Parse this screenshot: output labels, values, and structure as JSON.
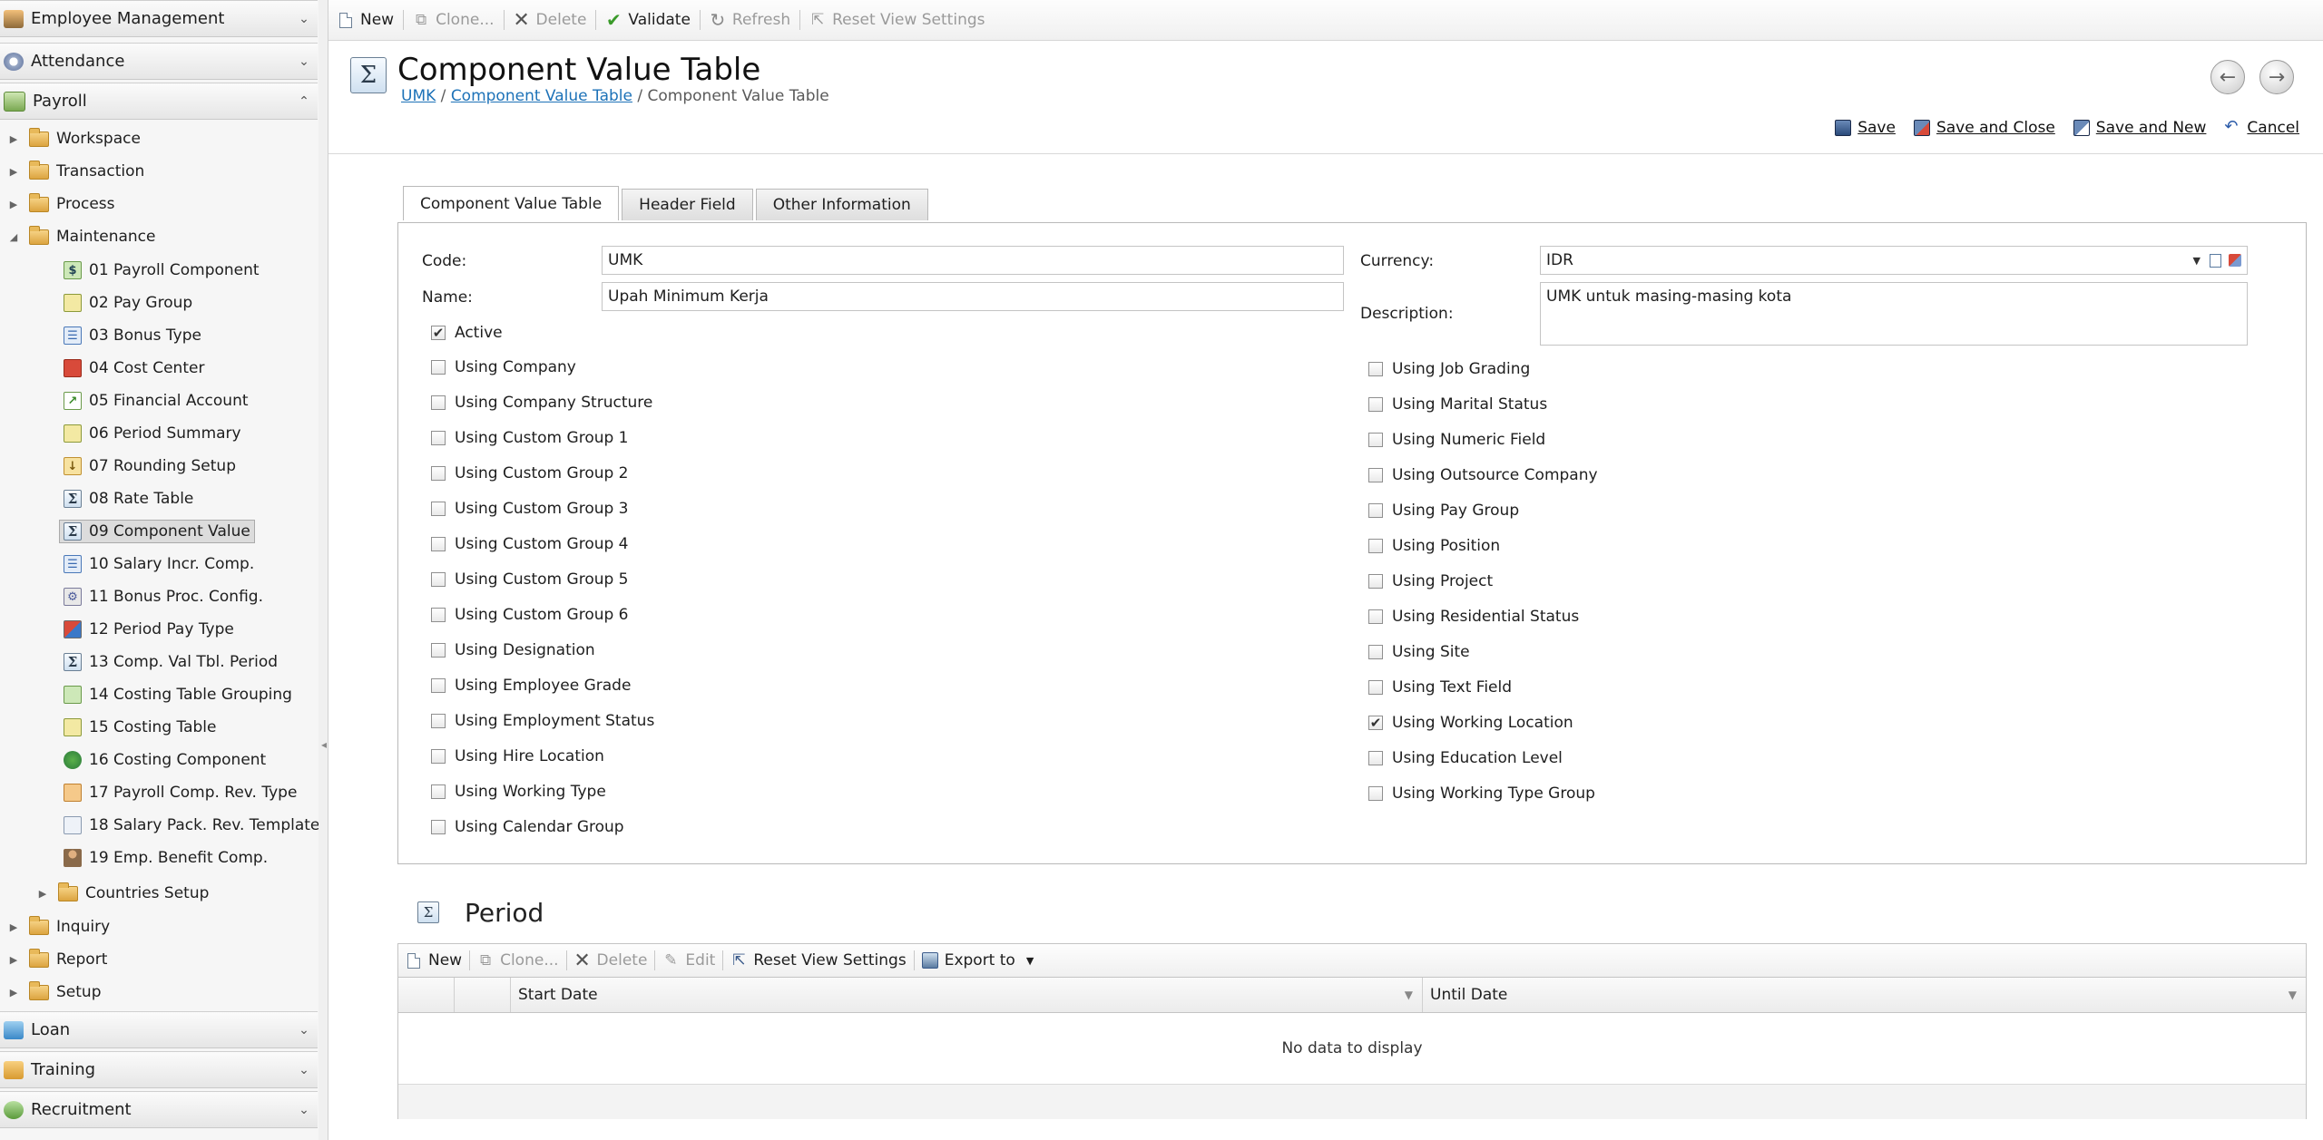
{
  "sidebar": {
    "top_groups": [
      {
        "label": "Employee Management"
      },
      {
        "label": "Attendance"
      },
      {
        "label": "Payroll"
      }
    ],
    "payroll_tree": {
      "workspace": "Workspace",
      "transaction": "Transaction",
      "process": "Process",
      "maintenance": "Maintenance",
      "maintenance_items": [
        "01 Payroll Component",
        "02 Pay Group",
        "03 Bonus Type",
        "04 Cost Center",
        "05 Financial Account",
        "06 Period Summary",
        "07 Rounding Setup",
        "08 Rate Table",
        "09 Component Value",
        "10 Salary Incr. Comp.",
        "11 Bonus Proc. Config.",
        "12 Period Pay Type",
        "13 Comp. Val Tbl. Period",
        "14 Costing Table Grouping",
        "15 Costing Table",
        "16 Costing Component",
        "17 Payroll Comp. Rev. Type",
        "18 Salary Pack. Rev. Template",
        "19 Emp. Benefit Comp."
      ],
      "countries_setup": "Countries Setup",
      "inquiry": "Inquiry",
      "report": "Report",
      "setup": "Setup"
    },
    "bottom_groups": [
      {
        "label": "Loan"
      },
      {
        "label": "Training"
      },
      {
        "label": "Recruitment"
      }
    ]
  },
  "toolbar": {
    "new": "New",
    "clone": "Clone...",
    "delete": "Delete",
    "validate": "Validate",
    "refresh": "Refresh",
    "reset_view": "Reset View Settings"
  },
  "header": {
    "title": "Component Value Table",
    "breadcrumb": {
      "link1": "UMK",
      "link2": "Component Value Table",
      "current": "Component Value Table"
    },
    "actions": {
      "save": "Save",
      "save_close": "Save and Close",
      "save_new": "Save and New",
      "cancel": "Cancel"
    }
  },
  "tabs": [
    "Component Value Table",
    "Header Field",
    "Other Information"
  ],
  "form": {
    "code_label": "Code:",
    "code_value": "UMK",
    "name_label": "Name:",
    "name_value": "Upah Minimum Kerja",
    "currency_label": "Currency:",
    "currency_value": "IDR",
    "description_label": "Description:",
    "description_value": "UMK untuk masing-masing kota",
    "active_label": "Active",
    "active_checked": true,
    "left_options": [
      {
        "label": "Using Company",
        "checked": false
      },
      {
        "label": "Using Company Structure",
        "checked": false
      },
      {
        "label": "Using Custom Group 1",
        "checked": false
      },
      {
        "label": "Using Custom Group 2",
        "checked": false
      },
      {
        "label": "Using Custom Group 3",
        "checked": false
      },
      {
        "label": "Using Custom Group 4",
        "checked": false
      },
      {
        "label": "Using Custom Group 5",
        "checked": false
      },
      {
        "label": "Using Custom Group 6",
        "checked": false
      },
      {
        "label": "Using Designation",
        "checked": false
      },
      {
        "label": "Using Employee Grade",
        "checked": false
      },
      {
        "label": "Using Employment Status",
        "checked": false
      },
      {
        "label": "Using Hire Location",
        "checked": false
      },
      {
        "label": "Using Working Type",
        "checked": false
      },
      {
        "label": "Using Calendar Group",
        "checked": false
      }
    ],
    "right_options": [
      {
        "label": "Using Job Grading",
        "checked": false
      },
      {
        "label": "Using Marital Status",
        "checked": false
      },
      {
        "label": "Using Numeric Field",
        "checked": false
      },
      {
        "label": "Using Outsource Company",
        "checked": false
      },
      {
        "label": "Using Pay Group",
        "checked": false
      },
      {
        "label": "Using Position",
        "checked": false
      },
      {
        "label": "Using Project",
        "checked": false
      },
      {
        "label": "Using Residential Status",
        "checked": false
      },
      {
        "label": "Using Site",
        "checked": false
      },
      {
        "label": "Using Text Field",
        "checked": false
      },
      {
        "label": "Using Working Location",
        "checked": true
      },
      {
        "label": "Using Education Level",
        "checked": false
      },
      {
        "label": "Using Working Type Group",
        "checked": false
      }
    ]
  },
  "period": {
    "title": "Period",
    "toolbar": {
      "new": "New",
      "clone": "Clone...",
      "delete": "Delete",
      "edit": "Edit",
      "reset_view": "Reset View Settings",
      "export": "Export to"
    },
    "columns": [
      "Start Date",
      "Until Date"
    ],
    "empty_text": "No data to display"
  },
  "colors": {
    "link": "#1d72b8",
    "validate_check": "#3a9a2a",
    "delete_x": "#555555"
  }
}
